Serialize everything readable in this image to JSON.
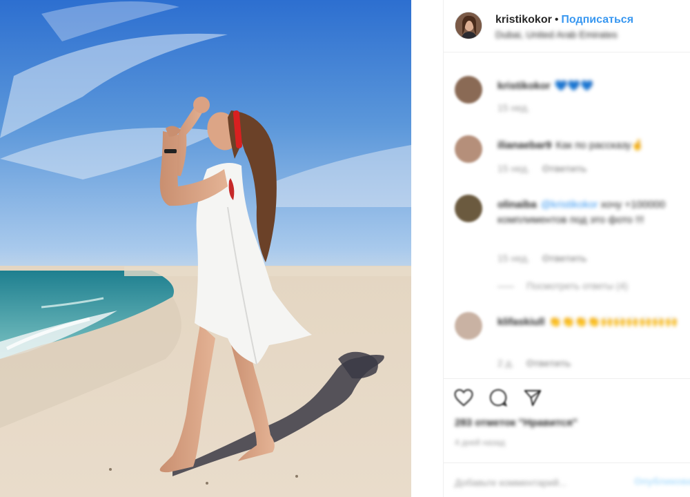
{
  "header": {
    "username": "kristikokor",
    "separator": "•",
    "follow_label": "Подписаться",
    "location": "Dubai, United Arab Emirates"
  },
  "comments": [
    {
      "username": "kristikokor",
      "text": "💙💙💙",
      "time": "15 нед.",
      "reply": "",
      "avatar_color": "#8a6a55"
    },
    {
      "username": "ilianaebar9",
      "text": "Как по рассказу🤞",
      "time": "15 нед.",
      "reply": "Ответить",
      "avatar_color": "#b58f7a"
    },
    {
      "username": "olinaiba",
      "mention": "@kristikokor",
      "text": "хочу +100000 комплиментов под это фото !!!",
      "time": "15 нед.",
      "reply": "Ответить",
      "avatar_color": "#6b5a3f"
    },
    {
      "username": "klifaskiull",
      "text": "👏👏👏👏🙌🙌🙌🙌🙌🙌",
      "time": "2 д.",
      "reply": "Ответить",
      "avatar_color": "#c9b2a3"
    }
  ],
  "view_replies": "Посмотреть ответы (4)",
  "actions": {
    "like_icon": "heart-icon",
    "comment_icon": "comment-icon",
    "share_icon": "share-icon"
  },
  "likes_text": "283 отметок \"Нравится\"",
  "post_date": "4 дней назад",
  "comment_box": {
    "placeholder": "Добавьте комментарий...",
    "publish_label": "Опубликовать"
  },
  "colors": {
    "accent": "#3897f0",
    "text": "#262626",
    "muted": "#999999",
    "border": "#efefef"
  }
}
